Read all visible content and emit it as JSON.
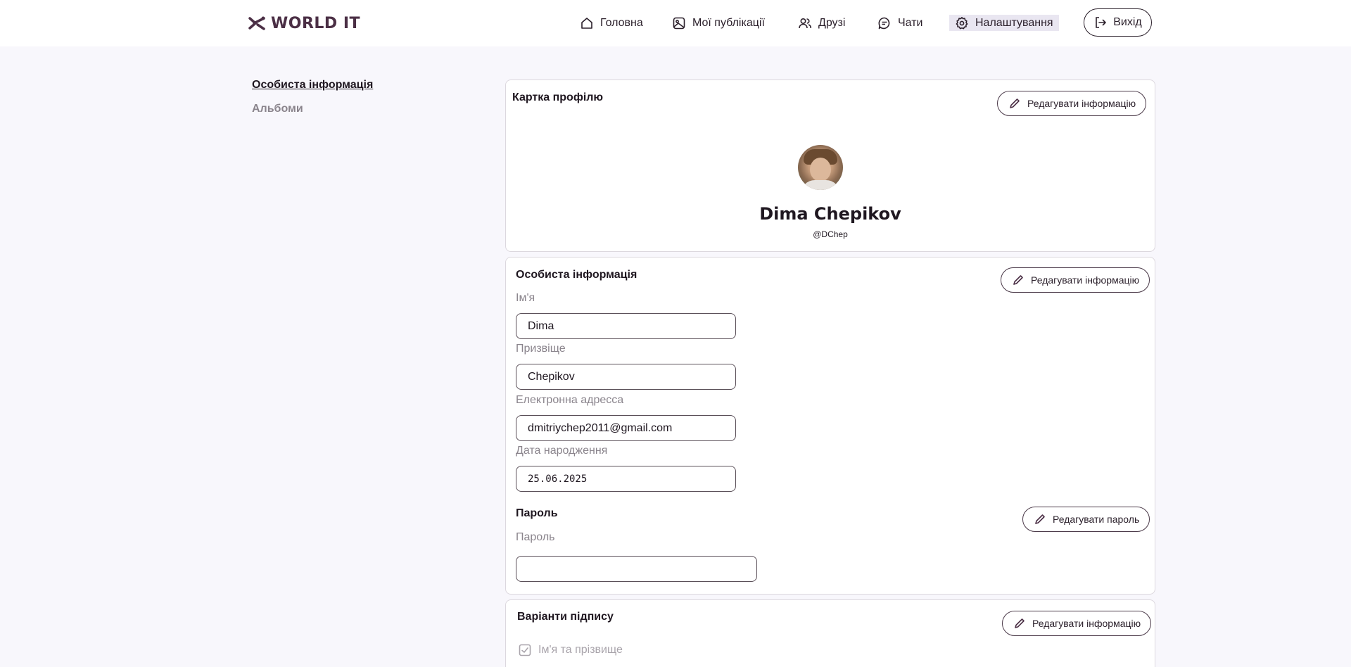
{
  "app": {
    "logo_text": "WORLD IT"
  },
  "nav": {
    "items": [
      {
        "label": "Головна",
        "icon": "home-icon"
      },
      {
        "label": "Мої публікації",
        "icon": "image-icon"
      },
      {
        "label": "Друзі",
        "icon": "users-icon"
      },
      {
        "label": "Чати",
        "icon": "chat-icon"
      },
      {
        "label": "Налаштування",
        "icon": "gear-icon",
        "active": true
      }
    ],
    "logout_label": "Вихід"
  },
  "sidebar": {
    "items": [
      {
        "label": "Особиста інформація",
        "active": true
      },
      {
        "label": "Альбоми",
        "active": false
      }
    ]
  },
  "profile_card": {
    "title": "Картка профілю",
    "edit_label": "Редагувати інформацію",
    "name": "Dima Chepikov",
    "handle": "@DChep"
  },
  "personal_info": {
    "title": "Особиста інформація",
    "edit_label": "Редагувати інформацію",
    "fields": [
      {
        "label": "Ім'я",
        "value": "Dima"
      },
      {
        "label": "Призвіще",
        "value": "Chepikov"
      },
      {
        "label": "Електронна адресса",
        "value": "dmitriychep2011@gmail.com"
      },
      {
        "label": "Дата народження",
        "value": "25.06.2025"
      }
    ],
    "password": {
      "title": "Пароль",
      "edit_label": "Редагувати пароль",
      "label": "Пароль",
      "value": ""
    }
  },
  "signature": {
    "title": "Варіанти підпису",
    "edit_label": "Редагувати інформацію",
    "options": [
      {
        "label": "Ім'я та прізвище",
        "checked": true
      }
    ]
  },
  "colors": {
    "brand": "#4b2f45",
    "background": "#f8f7fc",
    "active_nav_bg": "#e9e6f1"
  }
}
